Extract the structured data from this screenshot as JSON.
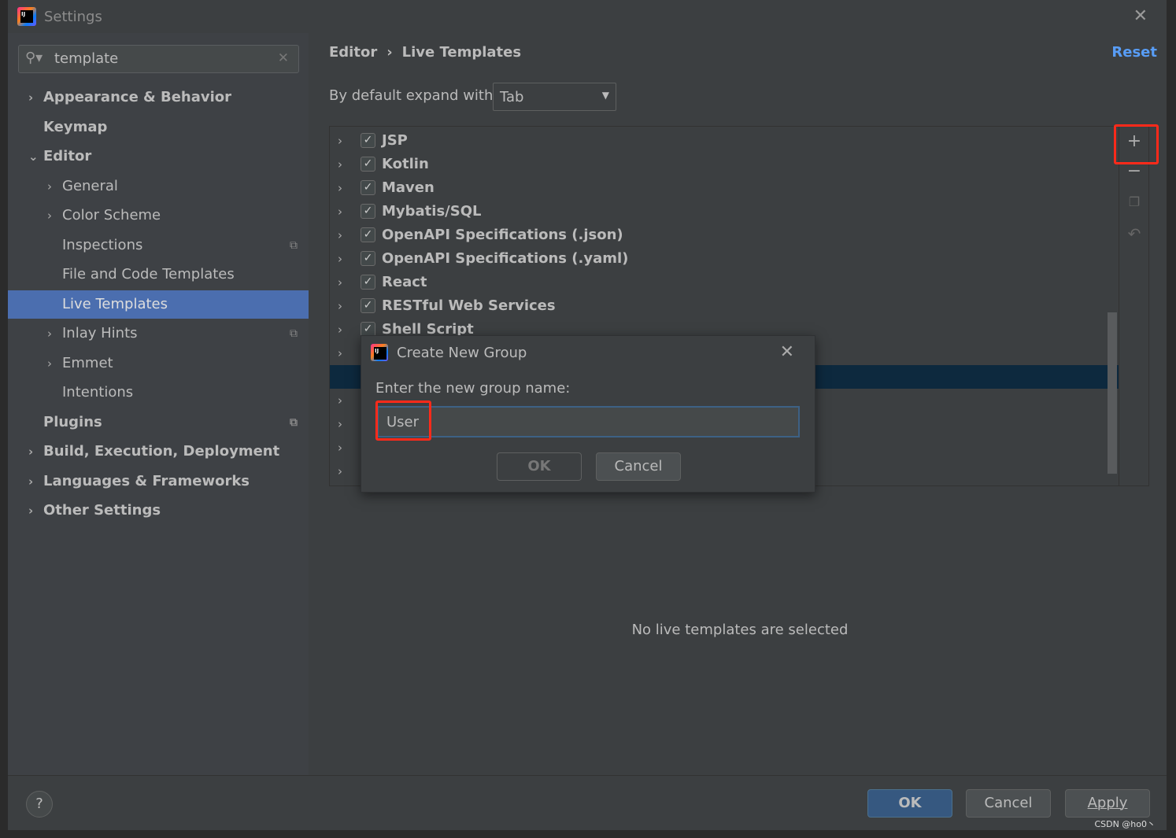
{
  "window": {
    "title": "Settings",
    "close_icon": "close-icon"
  },
  "search": {
    "value": "template"
  },
  "sidebar": {
    "items": [
      {
        "label": "Appearance & Behavior",
        "arrow": "›",
        "bold": true,
        "level": 0
      },
      {
        "label": "Keymap",
        "arrow": "",
        "bold": true,
        "level": 0
      },
      {
        "label": "Editor",
        "arrow": "⌄",
        "bold": true,
        "level": 0
      },
      {
        "label": "General",
        "arrow": "›",
        "bold": false,
        "level": 1
      },
      {
        "label": "Color Scheme",
        "arrow": "›",
        "bold": false,
        "level": 1
      },
      {
        "label": "Inspections",
        "arrow": "",
        "bold": false,
        "level": 1,
        "copy": true
      },
      {
        "label": "File and Code Templates",
        "arrow": "",
        "bold": false,
        "level": 1
      },
      {
        "label": "Live Templates",
        "arrow": "",
        "bold": false,
        "level": 1,
        "selected": true
      },
      {
        "label": "Inlay Hints",
        "arrow": "›",
        "bold": false,
        "level": 1,
        "copy": true
      },
      {
        "label": "Emmet",
        "arrow": "›",
        "bold": false,
        "level": 1
      },
      {
        "label": "Intentions",
        "arrow": "",
        "bold": false,
        "level": 1
      },
      {
        "label": "Plugins",
        "arrow": "",
        "bold": true,
        "level": 0,
        "copy": true
      },
      {
        "label": "Build, Execution, Deployment",
        "arrow": "›",
        "bold": true,
        "level": 0
      },
      {
        "label": "Languages & Frameworks",
        "arrow": "›",
        "bold": true,
        "level": 0
      },
      {
        "label": "Other Settings",
        "arrow": "›",
        "bold": true,
        "level": 0
      }
    ]
  },
  "breadcrumb": {
    "part1": "Editor",
    "sep": "›",
    "part2": "Live Templates"
  },
  "reset_label": "Reset",
  "expand": {
    "label": "By default expand with",
    "value": "Tab"
  },
  "groups": [
    "JSP",
    "Kotlin",
    "Maven",
    "Mybatis/SQL",
    "OpenAPI Specifications (.json)",
    "OpenAPI Specifications (.yaml)",
    "React",
    "RESTful Web Services",
    "Shell Script"
  ],
  "empty_message": "No live templates are selected",
  "dialog": {
    "title": "Create New Group",
    "prompt": "Enter the new group name:",
    "value": "User",
    "ok": "OK",
    "cancel": "Cancel"
  },
  "footer": {
    "help": "?",
    "ok": "OK",
    "cancel": "Cancel",
    "apply": "Apply",
    "watermark": "CSDN @ho0丶"
  },
  "colors": {
    "accent": "#4b6eaf",
    "link": "#589df6",
    "highlight": "#ff2a1a"
  }
}
